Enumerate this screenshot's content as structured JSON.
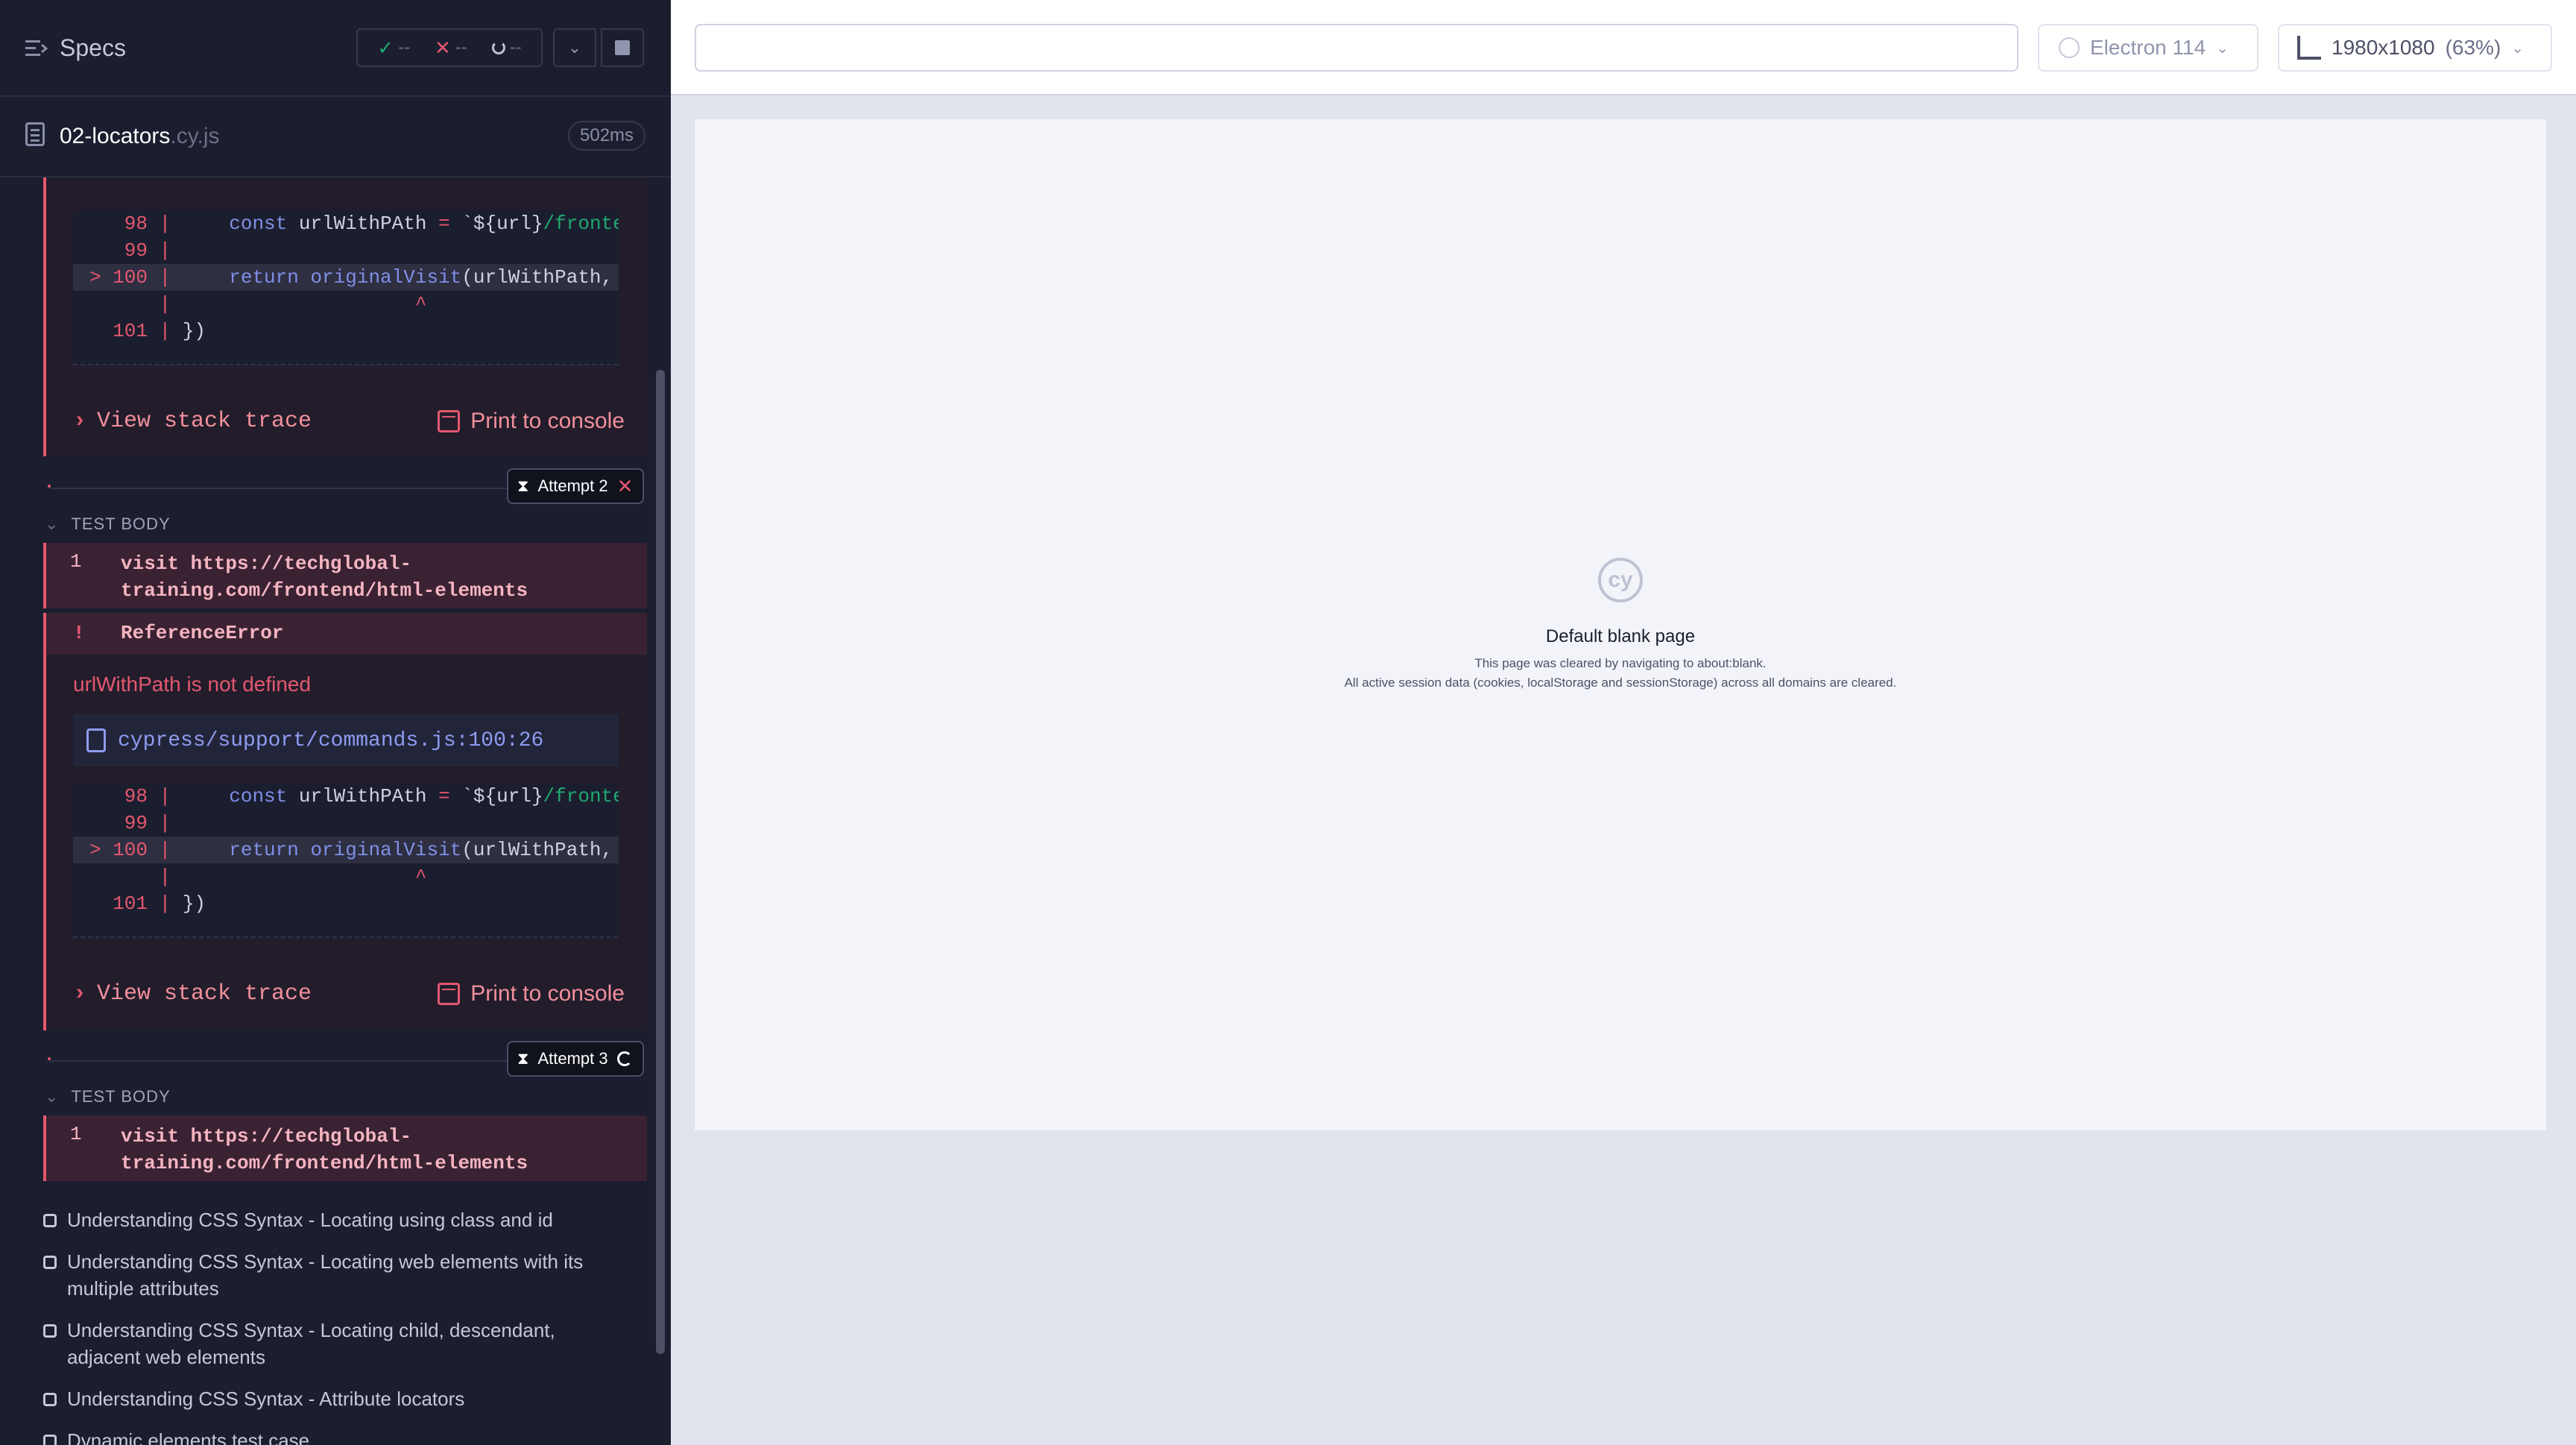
{
  "reporter": {
    "specs_label": "Specs",
    "stats": {
      "passed": "--",
      "failed": "--",
      "pending": "--"
    },
    "spec_name": "02-locators",
    "spec_ext": ".cy.js",
    "duration": "502ms"
  },
  "error1": {
    "code_lines": [
      {
        "n": "98",
        "code": "const urlWithPAth = `${url}/fronte"
      },
      {
        "n": "99",
        "code": ""
      },
      {
        "n": "> 100",
        "code": "return originalVisit(urlWithPath,"
      },
      {
        "n": "",
        "code": "                     ^"
      },
      {
        "n": "101",
        "code": "})"
      }
    ],
    "view_trace": "View stack trace",
    "print_console": "Print to console"
  },
  "attempt2": {
    "label": "Attempt 2",
    "test_body": "TEST BODY",
    "visit_num": "1",
    "visit_cmd": "visit",
    "visit_url": "https://techglobal-training.com/frontend/html-elements",
    "error_type": "ReferenceError",
    "error_msg": "urlWithPath is not defined",
    "file_link": "cypress/support/commands.js:100:26",
    "view_trace": "View stack trace",
    "print_console": "Print to console"
  },
  "attempt3": {
    "label": "Attempt 3",
    "test_body": "TEST BODY",
    "visit_num": "1",
    "visit_cmd": "visit",
    "visit_url": "https://techglobal-training.com/frontend/html-elements"
  },
  "tests": [
    "Understanding CSS Syntax - Locating using class and id",
    "Understanding CSS Syntax - Locating web elements with its multiple attributes",
    "Understanding CSS Syntax - Locating child, descendant, adjacent web elements",
    "Understanding CSS Syntax - Attribute locators",
    "Dynamic elements test case"
  ],
  "topbar": {
    "url_value": "",
    "browser": "Electron 114",
    "viewport": "1980x1080",
    "scale": "(63%)"
  },
  "aut": {
    "logo": "cy",
    "title": "Default blank page",
    "sub1": "This page was cleared by navigating to about:blank.",
    "sub2": "All active session data (cookies, localStorage and sessionStorage) across all domains are cleared."
  },
  "colors": {
    "reporter_bg": "#1b1e2e",
    "error_red": "#e45770",
    "pass_green": "#1fa971",
    "link_indigo": "#8e9bf0"
  }
}
